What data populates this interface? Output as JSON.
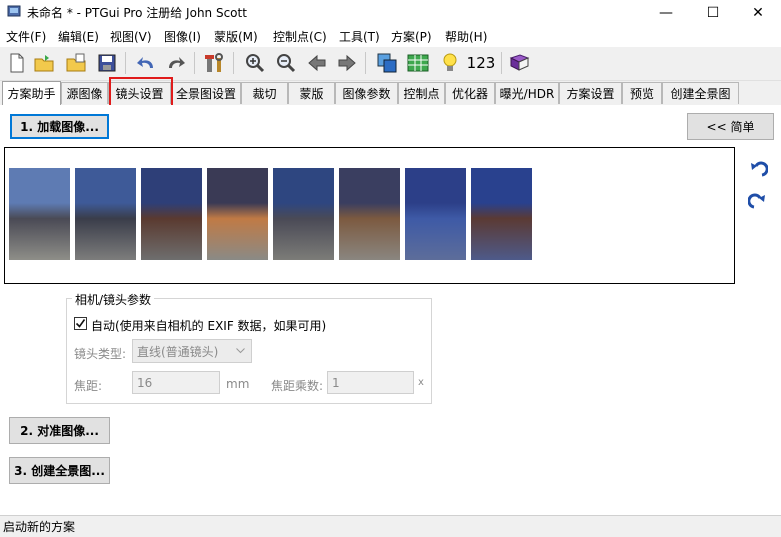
{
  "window": {
    "title": "未命名 * - PTGui Pro 注册给 John Scott",
    "minimize": "—",
    "maximize": "☐",
    "close": "✕"
  },
  "menu": [
    "文件(F)",
    "编辑(E)",
    "视图(V)",
    "图像(I)",
    "蒙版(M)",
    "控制点(C)",
    "工具(T)",
    "方案(P)",
    "帮助(H)"
  ],
  "toolbar": {
    "icons": [
      "new-file-icon",
      "open-folder-icon",
      "open-recent-icon",
      "save-icon",
      "undo-icon",
      "redo-icon",
      "tools-icon",
      "zoom-in-icon",
      "zoom-out-icon",
      "arrow-left-icon",
      "arrow-right-icon",
      "panorama-editor-icon",
      "table-icon",
      "lightbulb-icon",
      "numbers-icon",
      "book-icon"
    ],
    "numbers_label": "123"
  },
  "tabs": [
    "方案助手",
    "源图像",
    "镜头设置",
    "全景图设置",
    "裁切",
    "蒙版",
    "图像参数",
    "控制点",
    "优化器",
    "曝光/HDR",
    "方案设置",
    "预览",
    "创建全景图"
  ],
  "active_tab": "方案助手",
  "highlighted_tab": "镜头设置",
  "buttons": {
    "load_images": "1. 加载图像...",
    "simple": "<< 简单",
    "align_images": "2. 对准图像...",
    "create_panorama": "3. 创建全景图..."
  },
  "images": {
    "count": 8,
    "colors": [
      [
        "#5e7bb3",
        "#4a4a55",
        "#8e8e88"
      ],
      [
        "#3e5a98",
        "#3a3d4a",
        "#7d7d7c"
      ],
      [
        "#2e3f78",
        "#5a3a30",
        "#6e6e6e"
      ],
      [
        "#3a3a55",
        "#c07a45",
        "#8a8a86"
      ],
      [
        "#2e4680",
        "#4a4a56",
        "#7c7c78"
      ],
      [
        "#3a3e60",
        "#7c5a40",
        "#8a8680"
      ],
      [
        "#2c3f88",
        "#3e5aa6",
        "#5d6d9a"
      ],
      [
        "#29418e",
        "#5b3a34",
        "#4e5a8a"
      ]
    ]
  },
  "lens_group": {
    "title": "相机/镜头参数",
    "auto_checkbox_label": "自动(使用来自相机的 EXIF 数据，如果可用)",
    "auto_checked": true,
    "lens_type_label": "镜头类型:",
    "lens_type_value": "直线(普通镜头)",
    "focal_label": "焦距:",
    "focal_value": "16",
    "focal_unit": "mm",
    "multiplier_label": "焦距乘数:",
    "multiplier_value": "1",
    "multiplier_unit": "x"
  },
  "status": {
    "text": "启动新的方案"
  },
  "colors": {
    "highlight": "#e01b1b",
    "focus_border": "#0078d7"
  }
}
